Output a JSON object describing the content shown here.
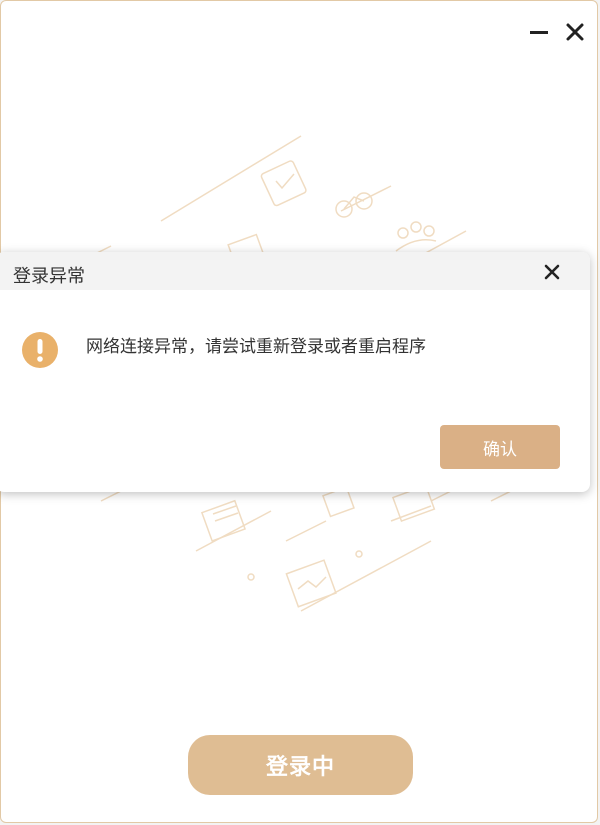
{
  "window": {
    "minimize_icon": "minimize-icon",
    "close_icon": "close-icon",
    "login_button_label": "登录中"
  },
  "dialog": {
    "title": "登录异常",
    "message": "网络连接异常，请尝试重新登录或者重启程序",
    "confirm_label": "确认",
    "icon": "warning-icon"
  },
  "colors": {
    "accent": "#dfbd93",
    "warning": "#e9b16a",
    "illustration": "#f0dcc2"
  }
}
